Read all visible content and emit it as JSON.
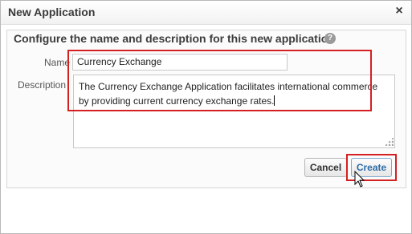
{
  "dialog": {
    "title": "New Application",
    "close_glyph": "×",
    "heading": "Configure the name and description for this new application",
    "help_glyph": "?"
  },
  "form": {
    "name_label": "Name",
    "name_value": "Currency Exchange",
    "description_label": "Description",
    "description_value": "The Currency Exchange Application facilitates international commerce by providing current currency exchange rates."
  },
  "buttons": {
    "cancel_label": "Cancel",
    "create_label": "Create"
  },
  "icons": {
    "help": "help-icon",
    "close": "close-icon",
    "cursor": "mouse-pointer-icon"
  },
  "colors": {
    "highlight": "#d42020",
    "create_text": "#2e6da4"
  }
}
